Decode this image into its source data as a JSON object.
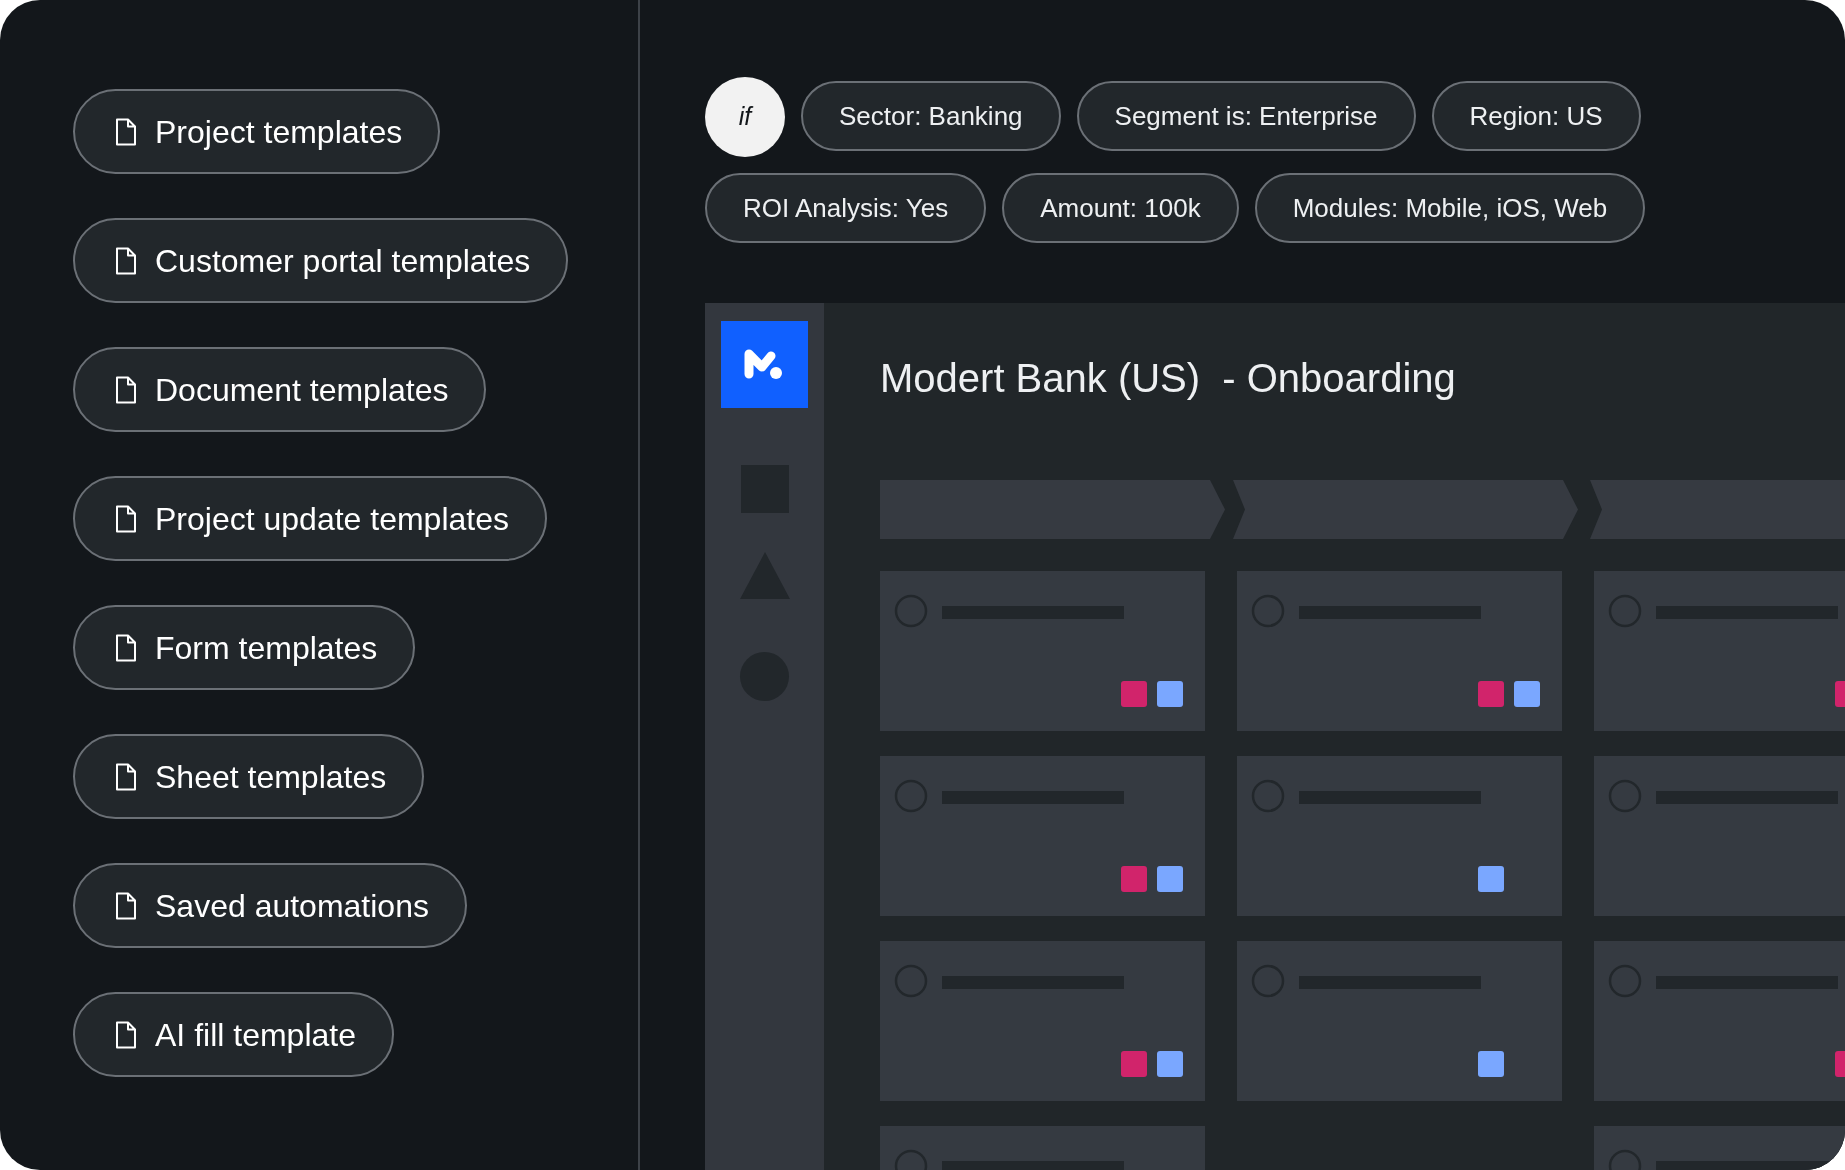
{
  "template_list": [
    {
      "label": "Project templates"
    },
    {
      "label": "Customer portal templates"
    },
    {
      "label": "Document templates"
    },
    {
      "label": "Project update templates"
    },
    {
      "label": "Form templates"
    },
    {
      "label": "Sheet templates"
    },
    {
      "label": "Saved automations"
    },
    {
      "label": "AI fill template"
    }
  ],
  "conditions": {
    "keyword": "if",
    "chips": [
      [
        "Sector: Banking",
        "Segment is: Enterprise",
        "Region: US"
      ],
      [
        "ROI Analysis: Yes",
        "Amount: 100k",
        "Modules: Mobile, iOS, Web"
      ]
    ]
  },
  "board": {
    "title": "Modert Bank (US)  - Onboarding",
    "columns": [
      {
        "cards": [
          {
            "kind": "task",
            "tags": [
              {
                "color": "#d1246b"
              },
              {
                "color": "#7aa7ff"
              }
            ]
          },
          {
            "kind": "task",
            "tags": [
              {
                "color": "#d1246b"
              },
              {
                "color": "#7aa7ff"
              }
            ]
          },
          {
            "kind": "task",
            "tags": [
              {
                "color": "#d1246b"
              },
              {
                "color": "#7aa7ff"
              }
            ]
          },
          {
            "kind": "task"
          }
        ]
      },
      {
        "cards": [
          {
            "kind": "task",
            "tags": [
              {
                "color": "#d1246b"
              },
              {
                "color": "#7aa7ff"
              }
            ]
          },
          {
            "kind": "task",
            "tags": [
              {
                "color": "#7aa7ff"
              }
            ]
          },
          {
            "kind": "task",
            "tags": [
              {
                "color": "#7aa7ff"
              }
            ]
          }
        ]
      },
      {
        "cards": [
          {
            "kind": "task",
            "tags": [
              {
                "color": "#d1246b"
              }
            ]
          },
          {
            "kind": "task"
          },
          {
            "kind": "task",
            "tags": [
              {
                "color": "#d1246b"
              }
            ]
          },
          {
            "kind": "task"
          }
        ]
      }
    ]
  }
}
